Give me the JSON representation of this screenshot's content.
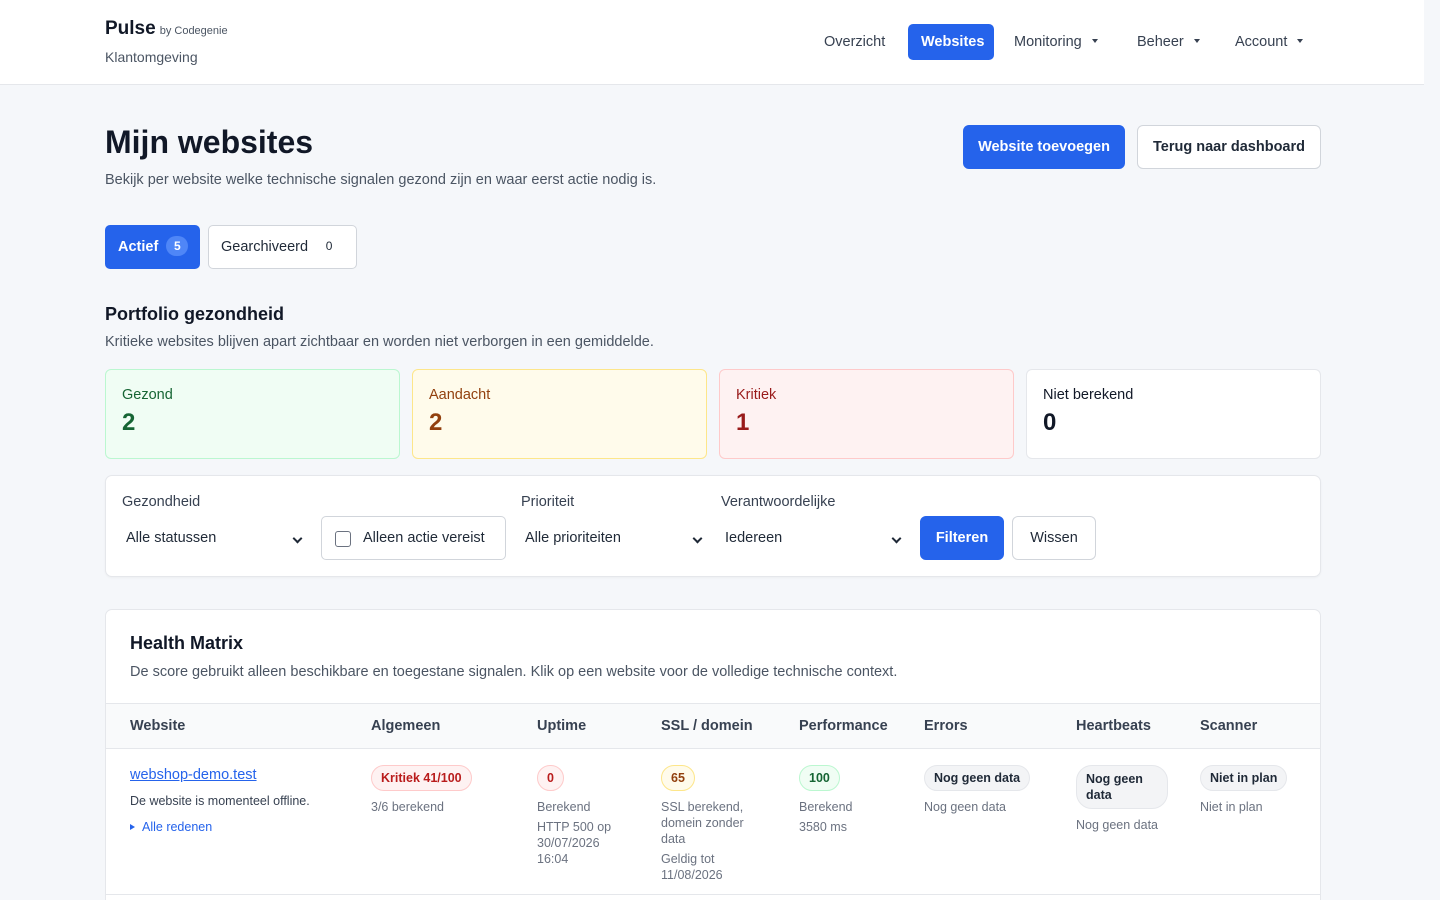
{
  "brand": {
    "name": "Pulse",
    "by": "by Codegenie",
    "subtitle": "Klantomgeving"
  },
  "nav": {
    "overzicht": "Overzicht",
    "websites": "Websites",
    "monitoring": "Monitoring",
    "beheer": "Beheer",
    "account": "Account"
  },
  "page": {
    "title": "Mijn websites",
    "description": "Bekijk per website welke technische signalen gezond zijn en waar eerst actie nodig is.",
    "add_button": "Website toevoegen",
    "back_button": "Terug naar dashboard"
  },
  "tabs": {
    "active": {
      "label": "Actief",
      "count": "5"
    },
    "archived": {
      "label": "Gearchiveerd",
      "count": "0"
    }
  },
  "portfolio": {
    "title": "Portfolio gezondheid",
    "description": "Kritieke websites blijven apart zichtbaar en worden niet verborgen in een gemiddelde.",
    "stats": {
      "healthy": {
        "label": "Gezond",
        "value": "2"
      },
      "attention": {
        "label": "Aandacht",
        "value": "2"
      },
      "critical": {
        "label": "Kritiek",
        "value": "1"
      },
      "not_calculated": {
        "label": "Niet berekend",
        "value": "0"
      }
    }
  },
  "filters": {
    "health_label": "Gezondheid",
    "health_value": "Alle statussen",
    "action_only_label": "Alleen actie vereist",
    "priority_label": "Prioriteit",
    "priority_value": "Alle prioriteiten",
    "owner_label": "Verantwoordelijke",
    "owner_value": "Iedereen",
    "filter_button": "Filteren",
    "clear_button": "Wissen"
  },
  "matrix": {
    "title": "Health Matrix",
    "description": "De score gebruikt alleen beschikbare en toegestane signalen. Klik op een website voor de volledige technische context.",
    "columns": {
      "website": "Website",
      "general": "Algemeen",
      "uptime": "Uptime",
      "ssl": "SSL / domein",
      "performance": "Performance",
      "errors": "Errors",
      "heartbeats": "Heartbeats",
      "scanner": "Scanner"
    },
    "rows": [
      {
        "website": "webshop-demo.test",
        "status": "De website is momenteel offline.",
        "reasons_link": "Alle redenen",
        "general_badge": "Kritiek 41/100",
        "general_sub": "3/6 berekend",
        "uptime_badge": "0",
        "uptime_sub1": "Berekend",
        "uptime_sub2": "HTTP 500 op",
        "uptime_sub3": "30/07/2026",
        "uptime_sub4": "16:04",
        "ssl_badge": "65",
        "ssl_sub1": "SSL berekend,",
        "ssl_sub2": "domein zonder",
        "ssl_sub3": "data",
        "ssl_sub4": "Geldig tot",
        "ssl_sub5": "11/08/2026",
        "performance_badge": "100",
        "performance_sub1": "Berekend",
        "performance_sub2": "3580 ms",
        "errors_badge": "Nog geen data",
        "errors_sub": "Nog geen data",
        "heartbeats_badge_1": "Nog geen",
        "heartbeats_badge_2": "data",
        "heartbeats_sub": "Nog geen data",
        "scanner_badge": "Niet in plan",
        "scanner_sub": "Niet in plan"
      }
    ]
  },
  "colors": {
    "primary": "#2563eb",
    "healthy": "#166534",
    "attention": "#92400e",
    "critical": "#991b1b"
  },
  "icons": {
    "dropdown": "chevron-down-icon",
    "nav_menu": "caret-down-icon",
    "disclosure": "triangle-right-icon"
  }
}
